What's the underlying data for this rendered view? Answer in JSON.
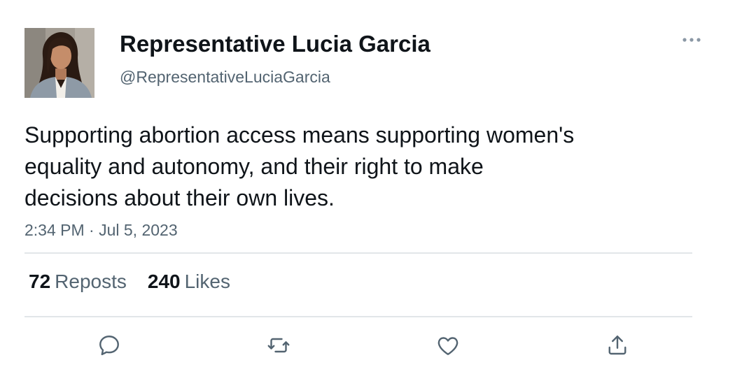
{
  "author": {
    "display_name": "Representative Lucia Garcia",
    "handle": "@RepresentativeLuciaGarcia",
    "avatar_icon": "profile-photo"
  },
  "tweet": {
    "text_lines": [
      "Supporting abortion access means supporting women's",
      "equality and autonomy, and their right to make",
      "decisions about their own lives."
    ],
    "timestamp": "2:34 PM · Jul 5, 2023"
  },
  "stats": {
    "reposts_count": "72",
    "reposts_label": "Reposts",
    "likes_count": "240",
    "likes_label": "Likes"
  },
  "actions": {
    "reply_icon": "speech-bubble-icon",
    "repost_icon": "repost-arrows-icon",
    "like_icon": "heart-icon",
    "share_icon": "share-upload-icon"
  },
  "colors": {
    "primary_text": "#0f1419",
    "secondary_text": "#536471",
    "divider": "#e2e6e9"
  }
}
